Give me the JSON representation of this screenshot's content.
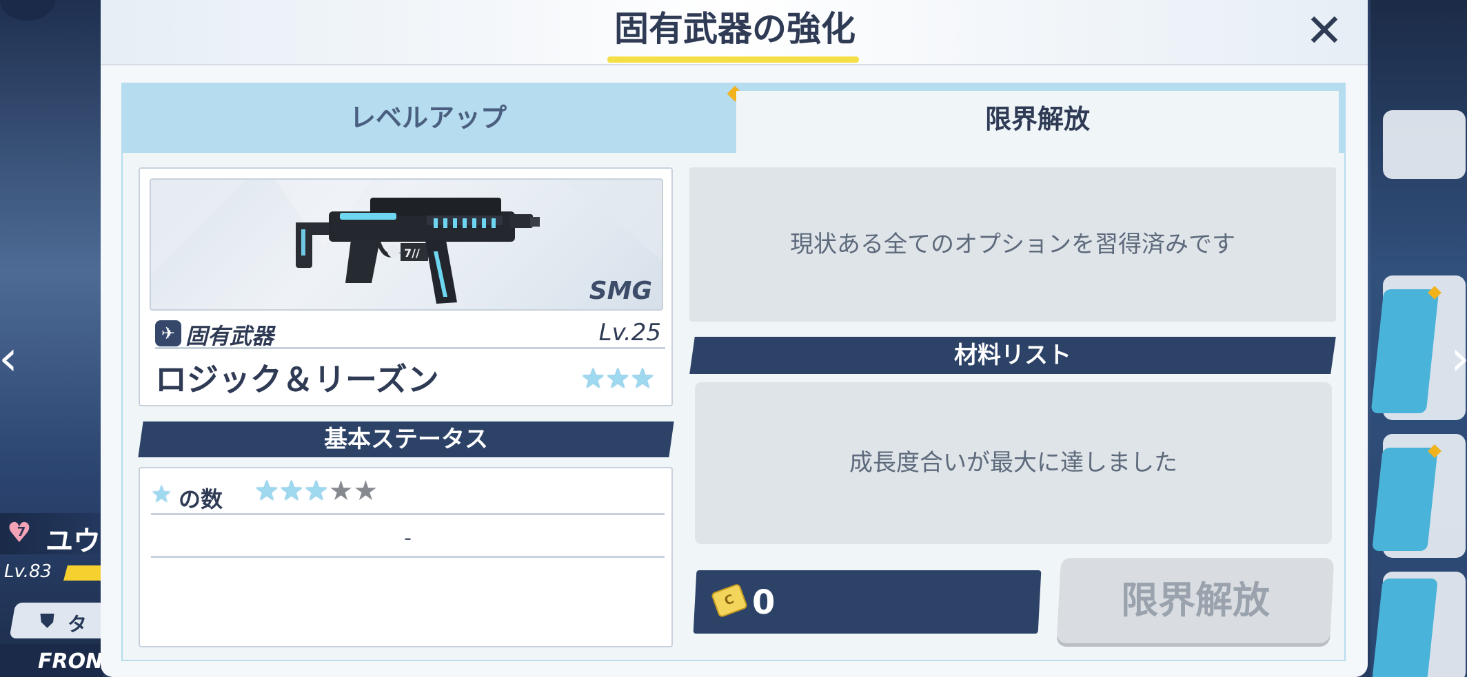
{
  "dialog": {
    "title": "固有武器の強化",
    "close_icon": "close-icon"
  },
  "tabs": [
    {
      "label": "レベルアップ",
      "active": false,
      "notice": true
    },
    {
      "label": "限界解放",
      "active": true
    }
  ],
  "weapon": {
    "type": "SMG",
    "category_label": "固有武器",
    "level": "Lv.25",
    "name": "ロジック＆リーズン",
    "stars": 3
  },
  "basic_status": {
    "header": "基本ステータス",
    "star_count_label": "の数",
    "stars_filled": 3,
    "stars_total": 5,
    "empty_value": "-"
  },
  "options": {
    "message": "現状ある全てのオプションを習得済みです"
  },
  "materials": {
    "header": "材料リスト",
    "message": "成長度合いが最大に達しました"
  },
  "currency": {
    "icon": "credit-card-icon",
    "value": "0"
  },
  "limit_button": {
    "label": "限界解放",
    "enabled": false
  },
  "background": {
    "character": {
      "affection": "7",
      "name": "ユウ",
      "level": "Lv.83",
      "role": "タン",
      "position": "FRONT"
    }
  },
  "colors": {
    "navy": "#2c4267",
    "tab_blue": "#b6dcf0",
    "accent_yellow": "#f5df47",
    "notice_orange": "#f2b21b",
    "star_blue": "#9ed9f0"
  }
}
